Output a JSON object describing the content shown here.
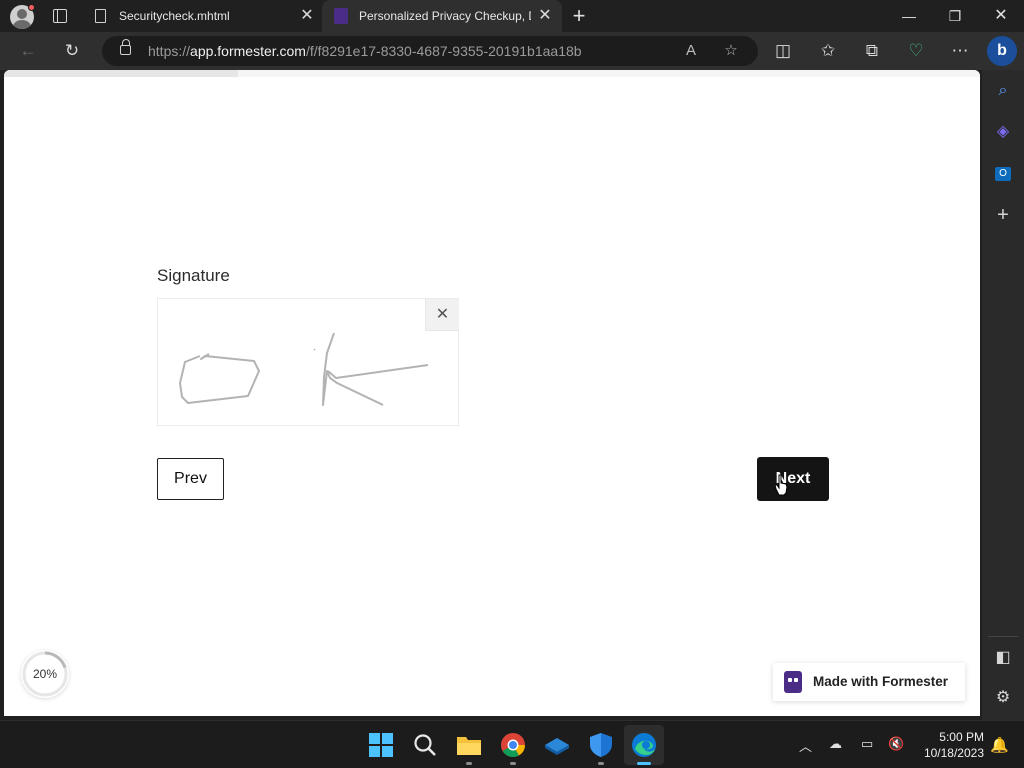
{
  "browser": {
    "tabs": [
      {
        "label": "Securitycheck.mhtml",
        "active": false
      },
      {
        "label": "Personalized Privacy Checkup, D",
        "active": true
      }
    ],
    "url_prefix": "https://",
    "url_host": "app.formester.com",
    "url_path": "/f/f8291e17-8330-4687-9355-20191b1aa18b"
  },
  "form": {
    "progress_fraction": 0.24,
    "field_label": "Signature",
    "clear_icon": "close-icon",
    "prev_label": "Prev",
    "next_label": "Next",
    "percent_label": "20%",
    "percent_value": 0.2,
    "branding_label": "Made with Formester"
  },
  "taskbar": {
    "time": "5:00 PM",
    "date": "10/18/2023"
  },
  "colors": {
    "brand": "#4b2d88",
    "next_button": "#141414"
  }
}
